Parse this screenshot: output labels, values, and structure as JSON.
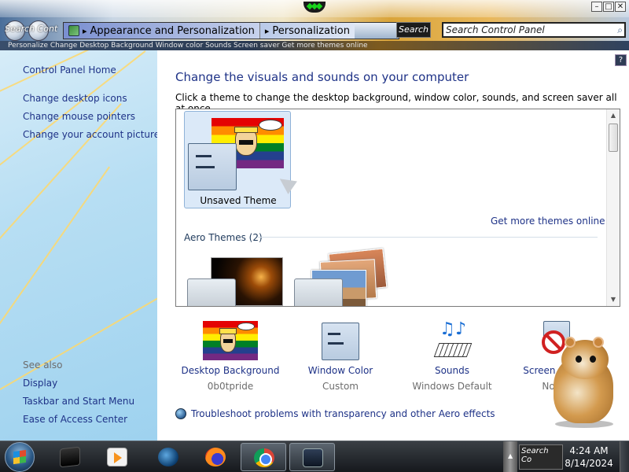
{
  "window": {
    "controls": {
      "minimize": "–",
      "maximize": "□",
      "close": "✕"
    },
    "search_conj_text": "Search Cont",
    "address": {
      "segments": [
        "Appearance and Personalization",
        "Personalization"
      ],
      "separator": "▸",
      "search_button_label": "Search",
      "search_placeholder": "Search Control Panel"
    },
    "menu_strip_text": "Personalize   Change   Desktop   Background   Window   color   Sounds   Screen   saver   Get   more   themes   online"
  },
  "sidebar": {
    "home": "Control Panel Home",
    "links": [
      "Change desktop icons",
      "Change mouse pointers",
      "Change your account picture"
    ],
    "see_also_title": "See also",
    "see_also": [
      "Display",
      "Taskbar and Start Menu",
      "Ease of Access Center"
    ]
  },
  "main": {
    "help": "?",
    "title": "Change the visuals and sounds on your computer",
    "subtitle": "Click a theme to change the desktop background, window color, sounds, and screen saver all at once.",
    "unsaved_theme": "Unsaved Theme",
    "more_themes": "Get more themes online",
    "aero_section": "Aero Themes (2)"
  },
  "tiles": [
    {
      "label": "Desktop Background",
      "value": "0b0tpride"
    },
    {
      "label": "Window Color",
      "value": "Custom"
    },
    {
      "label": "Sounds",
      "value": "Windows Default"
    },
    {
      "label": "Screen Saver",
      "value": "None"
    }
  ],
  "troubleshoot": "Troubleshoot problems with transparency and other Aero effects",
  "taskbar": {
    "tray_search_text": "Search Co",
    "clock": {
      "time": "4:24 AM",
      "date": "8/14/2024"
    }
  },
  "icons": [
    "back-icon",
    "forward-icon",
    "control-panel-icon",
    "search-icon",
    "help-icon",
    "globe-icon",
    "hamster-mascot",
    "start-orb-icon",
    "media-player-icon",
    "firefox-icon",
    "chrome-icon"
  ],
  "colors": {
    "link": "#1e3287",
    "sidebar": "#b7def3",
    "muted": "#6d6d6d",
    "taskbar": "#16191d"
  }
}
